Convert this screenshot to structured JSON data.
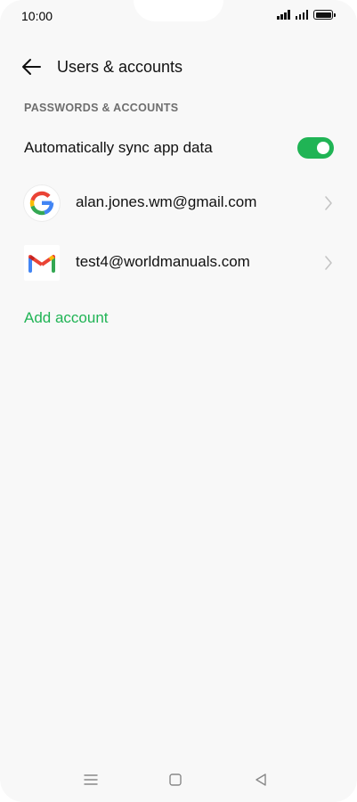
{
  "status_bar": {
    "time": "10:00"
  },
  "header": {
    "title": "Users & accounts",
    "back_icon": "arrow-left-icon"
  },
  "section": {
    "title": "PASSWORDS & ACCOUNTS"
  },
  "sync": {
    "label": "Automatically sync app data",
    "enabled": true
  },
  "accounts": [
    {
      "email": "alan.jones.wm@gmail.com",
      "icon": "google-icon"
    },
    {
      "email": "test4@worldmanuals.com",
      "icon": "gmail-icon"
    }
  ],
  "add_account_label": "Add account",
  "colors": {
    "accent": "#20b455",
    "background": "#f8f8f8",
    "section_text": "#6e6e6e"
  },
  "nav_bar": {
    "icons": [
      "menu-icon",
      "home-square-icon",
      "back-triangle-icon"
    ]
  }
}
